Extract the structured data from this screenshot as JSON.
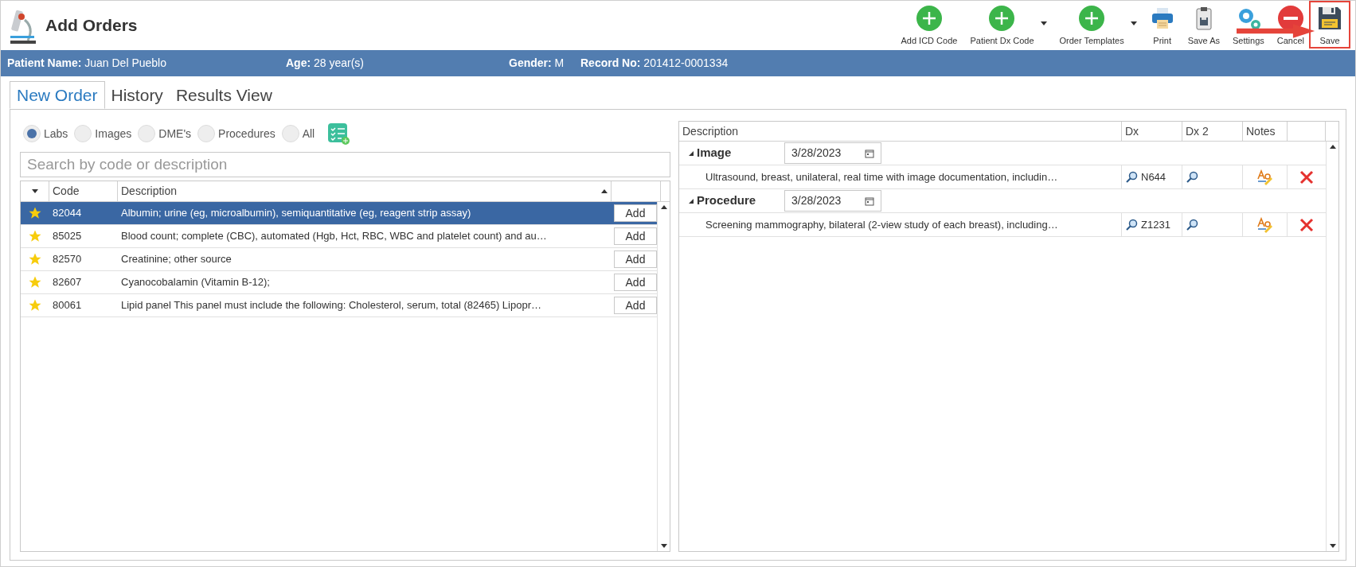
{
  "window": {
    "title": "Add Orders"
  },
  "toolbar": [
    {
      "kind": "add",
      "label": "Add ICD Code",
      "has_menu": false
    },
    {
      "kind": "add",
      "label": "Patient Dx Code",
      "has_menu": true
    },
    {
      "kind": "add",
      "label": "Order Templates",
      "has_menu": true
    },
    {
      "kind": "print",
      "label": "Print",
      "has_menu": false
    },
    {
      "kind": "saveas",
      "label": "Save As",
      "has_menu": false
    },
    {
      "kind": "settings",
      "label": "Settings",
      "has_menu": false
    },
    {
      "kind": "cancel",
      "label": "Cancel",
      "has_menu": false
    },
    {
      "kind": "save",
      "label": "Save",
      "has_menu": false,
      "highlighted": true
    }
  ],
  "patient_bar": [
    {
      "label": "Patient Name:",
      "value": "Juan Del Pueblo"
    },
    {
      "label": "Age:",
      "value": "28 year(s)"
    },
    {
      "label": "Gender:",
      "value": "M"
    },
    {
      "label": "Record No:",
      "value": "201412-0001334"
    }
  ],
  "tabs": [
    {
      "label": "New Order",
      "selected": true
    },
    {
      "label": "History",
      "selected": false
    },
    {
      "label": "Results View",
      "selected": false
    }
  ],
  "filters": [
    {
      "label": "Labs",
      "selected": true
    },
    {
      "label": "Images",
      "selected": false
    },
    {
      "label": "DME's",
      "selected": false
    },
    {
      "label": "Procedures",
      "selected": false
    },
    {
      "label": "All",
      "selected": false
    }
  ],
  "search": {
    "placeholder": "Search by code or description"
  },
  "catalog": {
    "columns": [
      "Code",
      "Description"
    ],
    "rows": [
      {
        "code": "82044",
        "description": "Albumin; urine (eg, microalbumin), semiquantitative (eg, reagent strip assay)",
        "favorite": true,
        "selected": true,
        "action": "Add"
      },
      {
        "code": "85025",
        "description": "Blood count; complete (CBC), automated (Hgb, Hct, RBC, WBC and platelet count) and au…",
        "favorite": true,
        "selected": false,
        "action": "Add"
      },
      {
        "code": "82570",
        "description": "Creatinine; other source",
        "favorite": true,
        "selected": false,
        "action": "Add"
      },
      {
        "code": "82607",
        "description": "Cyanocobalamin (Vitamin B-12);",
        "favorite": true,
        "selected": false,
        "action": "Add"
      },
      {
        "code": "80061",
        "description": "Lipid panel This panel must include the following: Cholesterol, serum, total (82465) Lipopr…",
        "favorite": true,
        "selected": false,
        "action": "Add"
      }
    ]
  },
  "orders": {
    "columns": [
      "Description",
      "Dx",
      "Dx 2",
      "Notes"
    ],
    "groups": [
      {
        "name": "Image",
        "date": "3/28/2023",
        "expanded": true,
        "items": [
          {
            "description": "Ultrasound, breast, unilateral, real time with image documentation, includin…",
            "dx": "N644"
          }
        ]
      },
      {
        "name": "Procedure",
        "date": "3/28/2023",
        "expanded": true,
        "items": [
          {
            "description": "Screening mammography, bilateral (2-view study of each breast), including…",
            "dx": "Z1231"
          }
        ]
      }
    ]
  }
}
